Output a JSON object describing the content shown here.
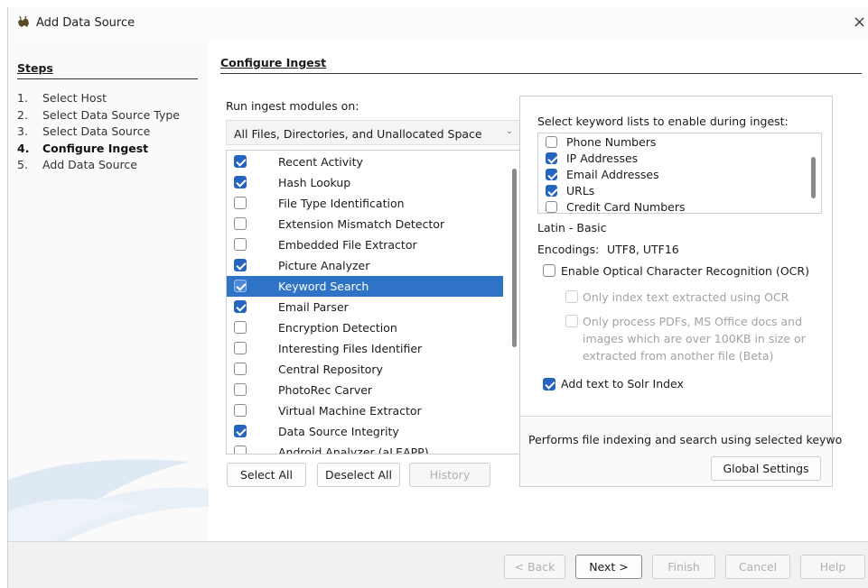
{
  "window": {
    "title": "Add Data Source",
    "close_symbol": "×"
  },
  "steps": {
    "header": "Steps",
    "items": [
      {
        "num": "1.",
        "label": "Select Host"
      },
      {
        "num": "2.",
        "label": "Select Data Source Type"
      },
      {
        "num": "3.",
        "label": "Select Data Source"
      },
      {
        "num": "4.",
        "label": "Configure Ingest",
        "active": true
      },
      {
        "num": "5.",
        "label": "Add Data Source"
      }
    ]
  },
  "content": {
    "header": "Configure Ingest",
    "run_label": "Run ingest modules on:",
    "run_option": "All Files, Directories, and Unallocated Space",
    "modules": [
      {
        "label": "Recent Activity",
        "checked": true
      },
      {
        "label": "Hash Lookup",
        "checked": true
      },
      {
        "label": "File Type Identification",
        "checked": false
      },
      {
        "label": "Extension Mismatch Detector",
        "checked": false
      },
      {
        "label": "Embedded File Extractor",
        "checked": false
      },
      {
        "label": "Picture Analyzer",
        "checked": true
      },
      {
        "label": "Keyword Search",
        "checked": true,
        "selected": true
      },
      {
        "label": "Email Parser",
        "checked": true
      },
      {
        "label": "Encryption Detection",
        "checked": false
      },
      {
        "label": "Interesting Files Identifier",
        "checked": false
      },
      {
        "label": "Central Repository",
        "checked": false
      },
      {
        "label": "PhotoRec Carver",
        "checked": false
      },
      {
        "label": "Virtual Machine Extractor",
        "checked": false
      },
      {
        "label": "Data Source Integrity",
        "checked": true
      },
      {
        "label": "Android Analyzer (aLEAPP)",
        "checked": false
      }
    ],
    "buttons": {
      "select_all": "Select All",
      "deselect_all": "Deselect All",
      "history": "History"
    }
  },
  "settings": {
    "keyword_label": "Select keyword lists to enable during ingest:",
    "keyword_lists": [
      {
        "label": "Phone Numbers",
        "checked": false
      },
      {
        "label": "IP Addresses",
        "checked": true
      },
      {
        "label": "Email Addresses",
        "checked": true
      },
      {
        "label": "URLs",
        "checked": true
      },
      {
        "label": "Credit Card Numbers",
        "checked": false
      }
    ],
    "script": "Latin - Basic",
    "encodings_label": "Encodings:",
    "encodings_value": "UTF8, UTF16",
    "ocr_label": "Enable Optical Character Recognition (OCR)",
    "ocr_only_index": "Only index text extracted using OCR",
    "ocr_only_process_lines": [
      "Only process PDFs, MS Office docs and",
      "images which are over 100KB in size or",
      "extracted from another file (Beta)"
    ],
    "solr_label": "Add text to Solr Index",
    "description": "Performs file indexing and search using selected keywo",
    "global_settings": "Global Settings"
  },
  "footer": {
    "back": "< Back",
    "next": "Next >",
    "finish": "Finish",
    "cancel": "Cancel",
    "help": "Help"
  },
  "colors": {
    "accent": "#2564bf",
    "selection": "#2e73c5"
  }
}
